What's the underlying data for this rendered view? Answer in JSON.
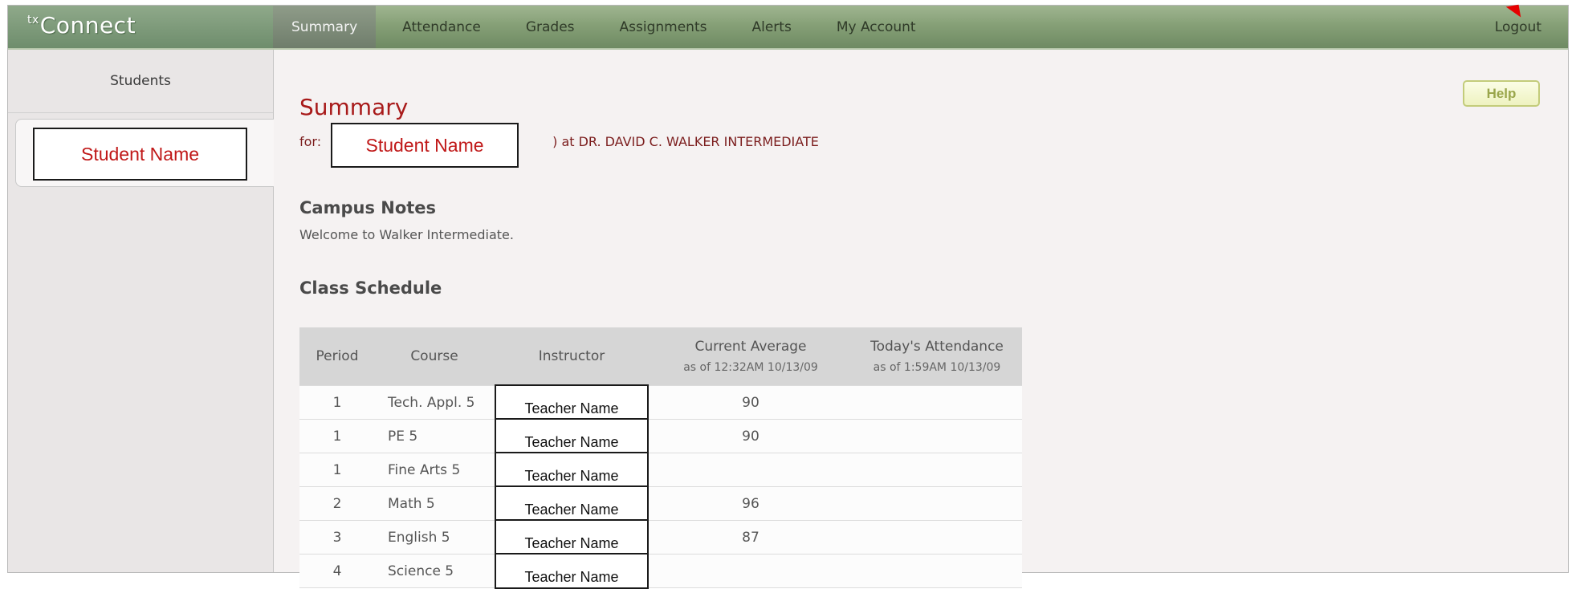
{
  "app": {
    "logo_sup": "tx",
    "logo_main": "Connect"
  },
  "nav": {
    "tabs": [
      "Summary",
      "Attendance",
      "Grades",
      "Assignments",
      "Alerts",
      "My Account"
    ],
    "active": "Summary",
    "logout": "Logout"
  },
  "sidebar": {
    "heading": "Students",
    "student": "Student Name"
  },
  "main": {
    "help": "Help",
    "title": "Summary",
    "for_prefix": "for:",
    "for_student": "Student Name",
    "for_campus": ") at DR. DAVID C. WALKER INTERMEDIATE",
    "campus_notes_heading": "Campus Notes",
    "campus_notes_text": "Welcome to Walker Intermediate.",
    "schedule_heading": "Class Schedule"
  },
  "schedule": {
    "headers": {
      "period": "Period",
      "course": "Course",
      "instructor": "Instructor",
      "average": "Current Average",
      "average_sub": "as of 12:32AM 10/13/09",
      "attendance": "Today's Attendance",
      "attendance_sub": "as of 1:59AM 10/13/09"
    },
    "rows": [
      {
        "period": "1",
        "course": "Tech. Appl. 5",
        "instructor": "Teacher Name",
        "average": "90",
        "attendance": ""
      },
      {
        "period": "1",
        "course": "PE 5",
        "instructor": "Teacher Name",
        "average": "90",
        "attendance": ""
      },
      {
        "period": "1",
        "course": "Fine Arts 5",
        "instructor": "Teacher Name",
        "average": "",
        "attendance": ""
      },
      {
        "period": "2",
        "course": "Math 5",
        "instructor": "Teacher Name",
        "average": "96",
        "attendance": ""
      },
      {
        "period": "3",
        "course": "English 5",
        "instructor": "Teacher Name",
        "average": "87",
        "attendance": ""
      },
      {
        "period": "4",
        "course": "Science 5",
        "instructor": "Teacher Name",
        "average": "",
        "attendance": ""
      }
    ]
  },
  "colors": {
    "topbar": "#86a077",
    "title_red": "#a81a1a",
    "annotation_red": "#e60000"
  }
}
